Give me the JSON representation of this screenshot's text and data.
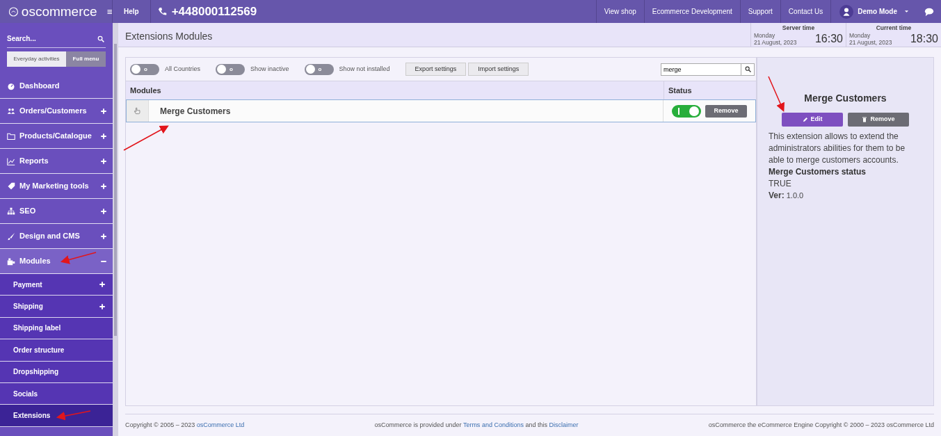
{
  "topbar": {
    "logo": "oscommerce",
    "help": "Help",
    "phone": "+448000112569",
    "links": [
      "View shop",
      "Ecommerce Development",
      "Support",
      "Contact Us"
    ],
    "user": "Demo Mode"
  },
  "sidebar": {
    "search": {
      "placeholder": "Search..."
    },
    "view_tabs": [
      {
        "label": "Everyday activities",
        "selected": false
      },
      {
        "label": "Full menu",
        "selected": true
      }
    ],
    "items": [
      {
        "label": "Dashboard",
        "expandable": false,
        "expanded": false
      },
      {
        "label": "Orders/Customers",
        "expandable": true,
        "expanded": false
      },
      {
        "label": "Products/Catalogue",
        "expandable": true,
        "expanded": false
      },
      {
        "label": "Reports",
        "expandable": true,
        "expanded": false
      },
      {
        "label": "My Marketing tools",
        "expandable": true,
        "expanded": false
      },
      {
        "label": "SEO",
        "expandable": true,
        "expanded": false
      },
      {
        "label": "Design and CMS",
        "expandable": true,
        "expanded": false
      },
      {
        "label": "Modules",
        "expandable": true,
        "expanded": true,
        "children": [
          {
            "label": "Payment",
            "expandable": true,
            "selected": false
          },
          {
            "label": "Shipping",
            "expandable": true,
            "selected": false
          },
          {
            "label": "Shipping label",
            "expandable": false,
            "selected": false
          },
          {
            "label": "Order structure",
            "expandable": false,
            "selected": false
          },
          {
            "label": "Dropshipping",
            "expandable": false,
            "selected": false
          },
          {
            "label": "Socials",
            "expandable": false,
            "selected": false
          },
          {
            "label": "Extensions",
            "expandable": false,
            "selected": true
          }
        ]
      }
    ]
  },
  "header": {
    "title": "Extensions Modules",
    "clocks": [
      {
        "label": "Server time",
        "day": "Monday",
        "date": "21 August, 2023",
        "time": "16:30"
      },
      {
        "label": "Current time",
        "day": "Monday",
        "date": "21 August, 2023",
        "time": "18:30"
      }
    ]
  },
  "filters": {
    "toggles": [
      {
        "label": "All Countries",
        "on": false,
        "knob": "o"
      },
      {
        "label": "Show inactive",
        "on": false,
        "knob": "o"
      },
      {
        "label": "Show not installed",
        "on": false,
        "knob": "o"
      }
    ],
    "buttons": [
      "Export settings",
      "Import settings"
    ],
    "search": {
      "value": "merge"
    }
  },
  "table": {
    "columns": [
      "Modules",
      "Status"
    ],
    "rows": [
      {
        "name": "Merge Customers",
        "enabled": true,
        "action": "Remove",
        "selected": true
      }
    ]
  },
  "detail": {
    "title": "Merge Customers",
    "buttons": [
      {
        "label": "Edit",
        "kind": "edit"
      },
      {
        "label": "Remove",
        "kind": "remove"
      }
    ],
    "description": "This extension allows to extend the administrators abilities for them to be able to merge customers accounts.",
    "status_label": "Merge Customers status",
    "status_value": "TRUE",
    "version": "**Ver:** 1.0.0"
  },
  "footer": {
    "left": [
      {
        "kind": "text",
        "text": "Copyright © 2005 – 2023 "
      },
      {
        "kind": "link",
        "text": "osCommerce Ltd"
      }
    ],
    "middle": [
      {
        "kind": "text",
        "text": "osCommerce is provided under "
      },
      {
        "kind": "link",
        "text": "Terms and Conditions"
      },
      {
        "kind": "text",
        "text": " and this "
      },
      {
        "kind": "link",
        "text": "Disclaimer"
      }
    ],
    "right": [
      {
        "kind": "text",
        "text": "osCommerce the eCommerce Engine Copyright © 2000 – 2023 osCommerce Ltd"
      }
    ]
  }
}
